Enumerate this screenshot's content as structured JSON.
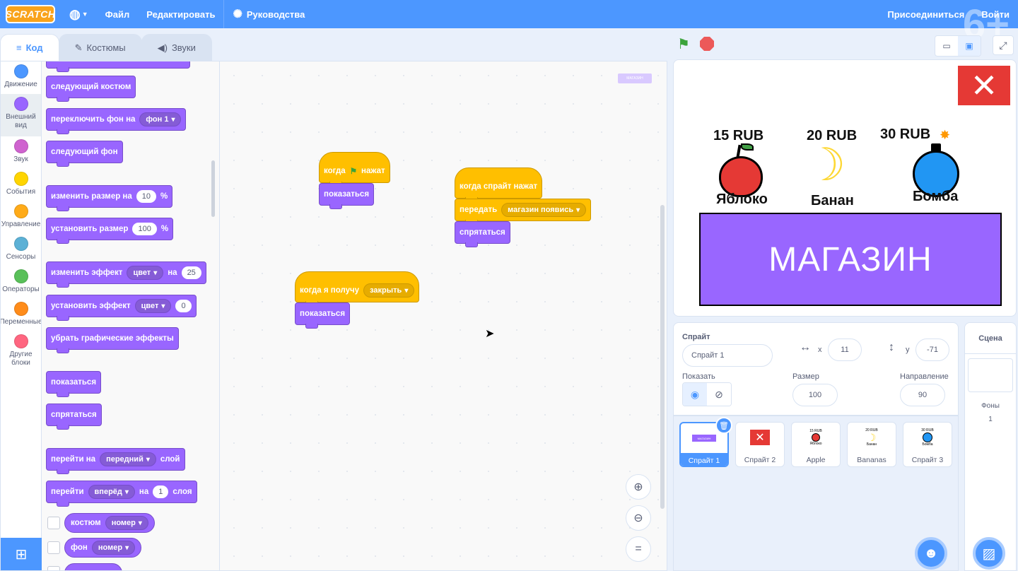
{
  "menubar": {
    "logo": "SCRATCH",
    "file": "Файл",
    "edit": "Редактировать",
    "tutorials": "Руководства",
    "join": "Присоединиться",
    "signin": "Войти",
    "age_badge": "6+"
  },
  "tabs": {
    "code": "Код",
    "costumes": "Костюмы",
    "sounds": "Звуки"
  },
  "categories": [
    {
      "label": "Движение",
      "color": "#4c97ff"
    },
    {
      "label": "Внешний вид",
      "color": "#9966ff"
    },
    {
      "label": "Звук",
      "color": "#cf63cf"
    },
    {
      "label": "События",
      "color": "#ffd500"
    },
    {
      "label": "Управление",
      "color": "#ffab19"
    },
    {
      "label": "Сенсоры",
      "color": "#5cb1d6"
    },
    {
      "label": "Операторы",
      "color": "#59c059"
    },
    {
      "label": "Переменные",
      "color": "#ff8c1a"
    },
    {
      "label": "Другие блоки",
      "color": "#ff6680"
    }
  ],
  "palette": {
    "next_costume": "следующий костюм",
    "switch_backdrop": "переключить фон на",
    "backdrop1": "фон 1",
    "next_backdrop": "следующий фон",
    "change_size": "изменить размер на",
    "change_size_val": "10",
    "percent": "%",
    "set_size": "установить размер",
    "set_size_val": "100",
    "change_effect": "изменить эффект",
    "color_opt": "цвет",
    "by": "на",
    "change_effect_val": "25",
    "set_effect": "установить эффект",
    "set_effect_val": "0",
    "clear_effects": "убрать графические эффекты",
    "show": "показаться",
    "hide": "спрятаться",
    "go_to": "перейти на",
    "front": "передний",
    "layer": "слой",
    "go": "перейти",
    "forward": "вперёд",
    "layers_val": "1",
    "layers": "слоя",
    "costume": "костюм",
    "number": "номер",
    "backdrop": "фон"
  },
  "scripts": {
    "when_flag": "когда",
    "clicked": "нажат",
    "show": "показаться",
    "when_sprite_clicked": "когда спрайт нажат",
    "broadcast": "передать",
    "broadcast_msg": "магазин появись",
    "hide": "спрятаться",
    "when_receive": "когда я получу",
    "receive_msg": "закрыть",
    "show2": "показаться",
    "minimap_label": "МАГАЗИН"
  },
  "stage": {
    "prices": [
      "15 RUB",
      "20 RUB",
      "30 RUB"
    ],
    "names": [
      "Яблоко",
      "Банан",
      "Бомба"
    ],
    "shop_label": "МАГАЗИН"
  },
  "sprite_info": {
    "sprite_label": "Спрайт",
    "sprite_name": "Спрайт 1",
    "x_label": "x",
    "x_value": "11",
    "y_label": "y",
    "y_value": "-71",
    "show_label": "Показать",
    "size_label": "Размер",
    "size_value": "100",
    "direction_label": "Направление",
    "direction_value": "90"
  },
  "sprites": [
    {
      "name": "Спрайт 1"
    },
    {
      "name": "Спрайт 2"
    },
    {
      "name": "Apple"
    },
    {
      "name": "Bananas"
    },
    {
      "name": "Спрайт 3"
    }
  ],
  "sprite_thumbs": {
    "shop": "МАГАЗИН",
    "p15": "15 RUB",
    "apple": "Яблоко",
    "p20": "20 RUB",
    "banana": "Банан",
    "p30": "30 RUB",
    "bomb": "Бомба"
  },
  "stage_panel": {
    "title": "Сцена",
    "backdrops_label": "Фоны",
    "backdrops_count": "1"
  }
}
